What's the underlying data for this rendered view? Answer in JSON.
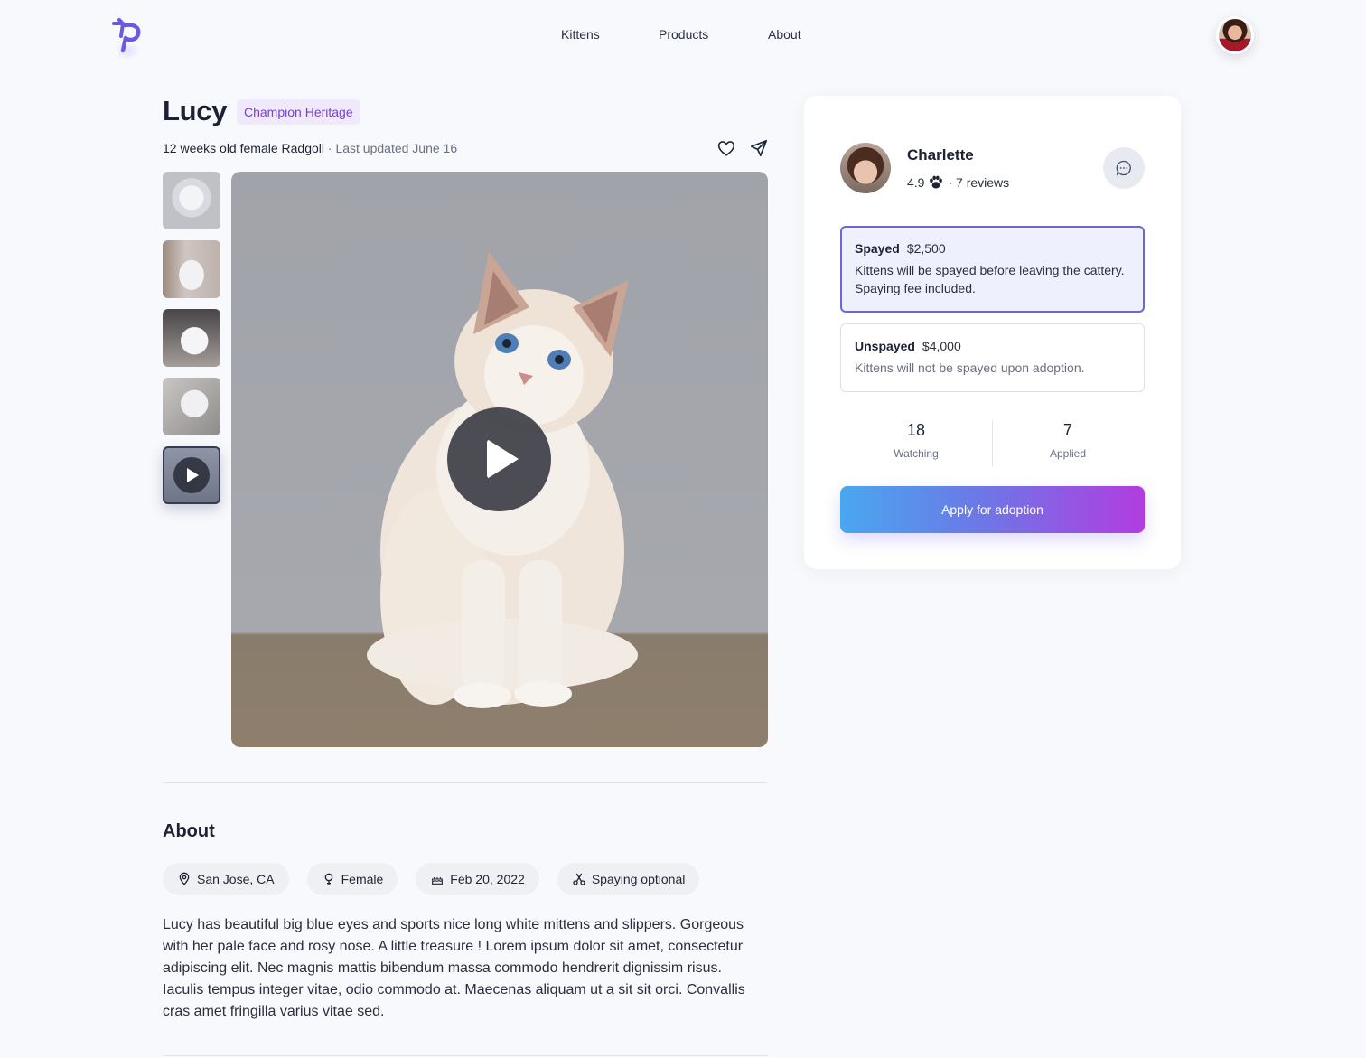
{
  "nav": {
    "items": [
      {
        "label": "Kittens"
      },
      {
        "label": "Products"
      },
      {
        "label": "About"
      }
    ]
  },
  "listing": {
    "name": "Lucy",
    "badge": "Champion Heritage",
    "subtitle": "12 weeks old female Radgoll",
    "separator": " · ",
    "updated": "Last updated June 16"
  },
  "gallery": {
    "thumbnails": [
      "thumb-1",
      "thumb-2",
      "thumb-3",
      "thumb-4",
      "thumb-video"
    ],
    "selected_index": 4
  },
  "about": {
    "title": "About",
    "chips": [
      {
        "icon": "location-pin-icon",
        "label": "San Jose, CA"
      },
      {
        "icon": "female-icon",
        "label": "Female"
      },
      {
        "icon": "cake-icon",
        "label": "Feb 20, 2022"
      },
      {
        "icon": "scissors-icon",
        "label": "Spaying optional"
      }
    ],
    "description": "Lucy has beautiful big blue eyes and sports nice long white mittens and slippers. Gorgeous with her pale face and rosy nose.  A little treasure ! Lorem ipsum dolor sit amet, consectetur adipiscing elit. Nec magnis mattis bibendum massa commodo hendrerit dignissim risus. Iaculis tempus integer vitae, odio commodo at. Maecenas aliquam ut a sit sit orci. Convallis cras amet fringilla varius vitae sed."
  },
  "seller": {
    "name": "Charlette",
    "rating": "4.9",
    "reviews": "· 7 reviews"
  },
  "options": [
    {
      "name": "Spayed",
      "price": "$2,500",
      "text": "Kittens will be spayed before leaving the cattery. Spaying fee included.",
      "selected": true
    },
    {
      "name": "Unspayed",
      "price": "$4,000",
      "text": "Kittens will not be spayed upon adoption.",
      "selected": false
    }
  ],
  "stats": [
    {
      "value": "18",
      "label": "Watching"
    },
    {
      "value": "7",
      "label": "Applied"
    }
  ],
  "cta": {
    "label": "Apply for adoption"
  },
  "colors": {
    "accent": "#6b68d6",
    "badge_text": "#7a3fd4",
    "badge_bg": "#efe9fb",
    "cta_gradient_start": "#4aa7f0",
    "cta_gradient_end": "#b33ce0"
  }
}
